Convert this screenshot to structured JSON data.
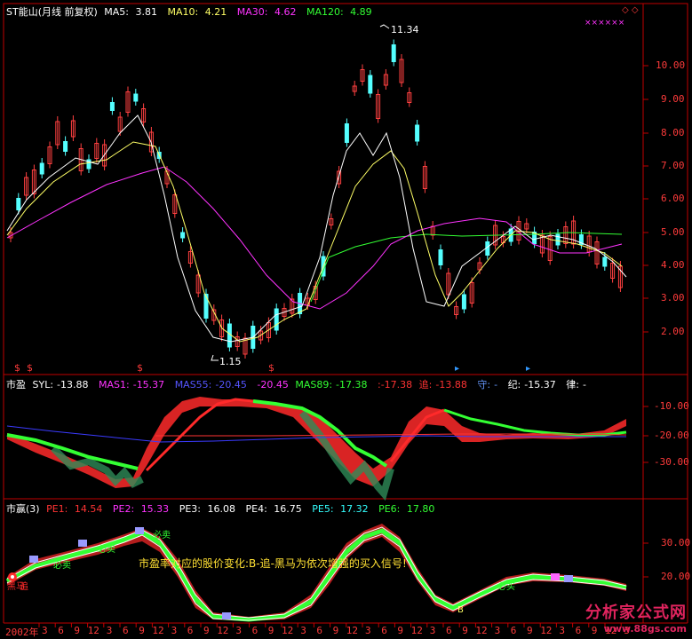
{
  "colors": {
    "background": "#000000",
    "grid_red": "#c00000",
    "candle_up": "#ff4040",
    "candle_down": "#54ffff",
    "ma5": "#ffffff",
    "ma10": "#ffff66",
    "ma30": "#ff33ff",
    "ma120": "#33ff33"
  },
  "main_panel": {
    "title": "ST能山(月线 前复权)",
    "ma5_label": "MA5:",
    "ma5_value": "3.81",
    "ma10_label": "MA10:",
    "ma10_value": "4.21",
    "ma30_label": "MA30:",
    "ma30_value": "4.62",
    "ma120_label": "MA120:",
    "ma120_value": "4.89",
    "high_marker": "11.34",
    "low_marker": "1.15",
    "y_ticks": [
      "10.00",
      "9.00",
      "8.00",
      "7.00",
      "6.00",
      "5.00",
      "4.00",
      "3.00",
      "2.00"
    ]
  },
  "pe_panel": {
    "name": "市盈",
    "syl_label": "SYL:",
    "syl_value": "-13.88",
    "mas1_label": "MAS1:",
    "mas1_value": "-15.37",
    "mas55_label": "MAS55:",
    "mas55_value": "-20.45",
    "mas55_extra": "-20.45",
    "mas89_label": "MAS89:",
    "mas89_value": "-17.38",
    "extra1_value": ":-17.38",
    "zhui_label": "追:",
    "zhui_value": "-13.88",
    "shou_label": "守:",
    "shou_value": "-",
    "ji_label": "纪:",
    "ji_value": "-15.37",
    "lv_label": "律:",
    "lv_value": "-",
    "y_ticks": [
      "-10.00",
      "-20.00",
      "-30.00"
    ]
  },
  "ratio_panel": {
    "name": "市赢(3)",
    "pe1_label": "PE1:",
    "pe1_value": "14.54",
    "pe2_label": "PE2:",
    "pe2_value": "15.33",
    "pe3_label": "PE3:",
    "pe3_value": "16.08",
    "pe4_label": "PE4:",
    "pe4_value": "16.75",
    "pe5_label": "PE5:",
    "pe5_value": "17.32",
    "pe6_label": "PE6:",
    "pe6_value": "17.80",
    "caption": "市盈率对应的股价变化:B-追-黑马为依次增强的买入信号!",
    "y_ticks": [
      "30.00",
      "20.00"
    ]
  },
  "x_axis": {
    "first_label": "2002年",
    "labels": [
      "3",
      "6",
      "9",
      "12",
      "3",
      "6",
      "9",
      "12",
      "3",
      "6",
      "9",
      "12",
      "3",
      "6",
      "9",
      "12",
      "3",
      "6",
      "9",
      "12",
      "3",
      "6",
      "9",
      "12",
      "3",
      "6",
      "9",
      "12",
      "3",
      "6",
      "9",
      "12",
      "3",
      "6",
      "9",
      "12",
      "3"
    ]
  },
  "watermark": {
    "title": "分析家公式网",
    "url": "www.88gs.com"
  },
  "signals": {
    "dollar_marks": [
      "$",
      "$",
      "$",
      "$"
    ],
    "annotations": [
      "必卖",
      "必卖",
      "必卖",
      "黑马",
      "追",
      "B",
      "必买"
    ]
  }
}
